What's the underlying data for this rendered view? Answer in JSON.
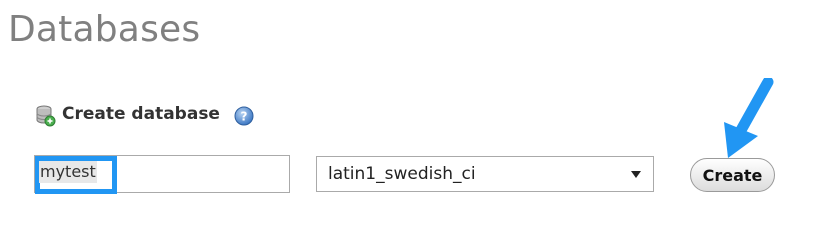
{
  "page": {
    "title": "Databases"
  },
  "create_database": {
    "label": "Create database",
    "help_icon": "help-icon",
    "db_icon": "database-add-icon"
  },
  "form": {
    "database_name": "mytest",
    "collation_selected": "latin1_swedish_ci",
    "create_label": "Create"
  },
  "colors": {
    "highlight": "#2196f3",
    "pointer_arrow": "#2196f3",
    "title": "#808080"
  }
}
